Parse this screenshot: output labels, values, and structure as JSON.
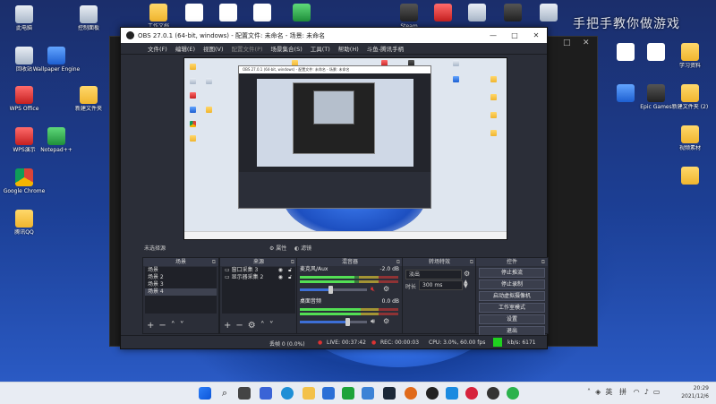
{
  "watermark": "手把手教你做游戏",
  "desktop": {
    "icons": [
      {
        "label": "此电脑",
        "name": "desktop-icon-this-pc"
      },
      {
        "label": "回收站",
        "name": "desktop-icon-recycle-bin"
      },
      {
        "label": "Wallpaper Engine",
        "name": "desktop-icon-wallpaper-engine"
      },
      {
        "label": "WPS Office",
        "name": "desktop-icon-wps-office"
      },
      {
        "label": "WPS演示",
        "name": "desktop-icon-wps-present"
      },
      {
        "label": "Google Chrome",
        "name": "desktop-icon-chrome"
      },
      {
        "label": "腾讯QQ",
        "name": "desktop-icon-qq"
      },
      {
        "label": "Notepad++",
        "name": "desktop-icon-notepadpp"
      },
      {
        "label": "控制面板",
        "name": "desktop-icon-control-panel"
      },
      {
        "label": "新建文件夹",
        "name": "desktop-icon-folder-1"
      },
      {
        "label": "工作文档",
        "name": "desktop-icon-folder-2"
      },
      {
        "label": "Steam",
        "name": "desktop-icon-steam"
      },
      {
        "label": "学习资料",
        "name": "desktop-icon-folder-3"
      },
      {
        "label": "新建文件夹 (2)",
        "name": "desktop-icon-folder-4"
      },
      {
        "label": "Epic Games",
        "name": "desktop-icon-epic"
      },
      {
        "label": "视频素材",
        "name": "desktop-icon-folder-5"
      }
    ]
  },
  "obs": {
    "title": "OBS 27.0.1 (64-bit, windows) - 配置文件: 未命名 - 场景: 未命名",
    "menu": [
      "文件(F)",
      "编辑(E)",
      "视图(V)",
      "配置文件(P)",
      "场景集合(S)",
      "工具(T)",
      "帮助(H)",
      "斗鱼-腾讯手柄"
    ],
    "status_row": {
      "no_source": "未选择源",
      "properties": "属性",
      "filters": "滤镜"
    },
    "scenes": {
      "header": "场景",
      "items": [
        "场景",
        "场景 2",
        "场景 3",
        "场景 4"
      ],
      "selected": 3
    },
    "sources": {
      "header": "来源",
      "items": [
        "窗口采集 3",
        "显示器采集 2"
      ]
    },
    "mixer": {
      "header": "混音器",
      "channels": [
        {
          "name": "麦克风/Aux",
          "db": "-2.0 dB",
          "level": 0.55,
          "volume": 0.45,
          "muted": true
        },
        {
          "name": "桌面音频",
          "db": "0.0 dB",
          "level": 0.62,
          "volume": 0.7,
          "muted": false
        }
      ]
    },
    "transitions": {
      "header": "转场特效",
      "type": "淡出",
      "duration_label": "时长",
      "duration": "300 ms"
    },
    "controls": {
      "header": "控件",
      "buttons": [
        "停止推流",
        "停止录制",
        "启动虚拟摄像机",
        "工作室模式",
        "设置",
        "退出"
      ]
    },
    "statusbar": {
      "dropped": "丢帧 0 (0.0%)",
      "live": "LIVE: 00:37:42",
      "rec": "REC: 00:00:03",
      "cpu": "CPU: 3.0%, 60.00 fps",
      "kbps": "kb/s: 6171"
    }
  },
  "taskbar": {
    "lang": "英",
    "ime": "拼",
    "time": "20:29",
    "date": "2021/12/6"
  },
  "colors": {
    "obs_bg": "#2b2e38",
    "accent": "#3d6fd6",
    "live_green": "#1fd21f"
  }
}
